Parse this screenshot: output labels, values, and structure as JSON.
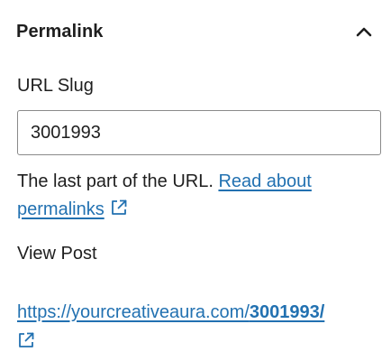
{
  "panel": {
    "title": "Permalink",
    "toggle_icon": "chevron-up-icon"
  },
  "slug": {
    "label": "URL Slug",
    "value": "3001993"
  },
  "help": {
    "text": "The last part of the URL. ",
    "link_text": "Read about permalinks",
    "link_icon": "external-link-icon"
  },
  "view_post": {
    "label": "View Post",
    "url_prefix": "https://yourcreativeaura.com/",
    "url_slug": "3001993/",
    "link_icon": "external-link-icon"
  },
  "colors": {
    "link": "#2271b1",
    "text": "#1e1e1e",
    "input_border": "#8a8a8a"
  }
}
